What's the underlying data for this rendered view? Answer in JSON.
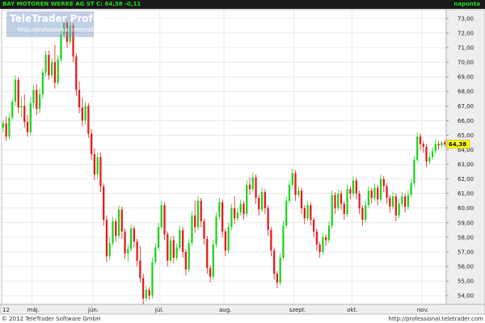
{
  "header": {
    "title": "BAY MOTOREN WERKE AG ST  C: 64,38  -0,11",
    "period": "naponta"
  },
  "watermark": {
    "brand": "TeleTrader Professional",
    "url": "http://professional.teletrader.com"
  },
  "footer": {
    "copyright": "© 2012 TeleTrader Software GmbH",
    "url": "http://professional.teletrader.com"
  },
  "colors": {
    "up": "#1fd21f",
    "down": "#e81818",
    "grid": "#d6d6d6",
    "axis_bg": "#eeeeee",
    "last_price_bg": "#ffff00"
  },
  "chart_data": {
    "type": "candlestick",
    "series_name": "BAY MOTOREN WERKE AG ST",
    "last_close": "64,38",
    "change": "-0,11",
    "y_ticks": [
      "54,00",
      "55,00",
      "56,00",
      "57,00",
      "58,00",
      "59,00",
      "60,00",
      "61,00",
      "62,00",
      "63,00",
      "64,00",
      "65,00",
      "66,00",
      "67,00",
      "68,00",
      "69,00",
      "70,00",
      "71,00",
      "72,00",
      "73,00"
    ],
    "ylim": [
      53.4,
      73.6
    ],
    "x_ticks": [
      {
        "label": "12",
        "index": 0
      },
      {
        "label": "máj.",
        "index": 10
      },
      {
        "label": "jún.",
        "index": 30
      },
      {
        "label": "júl.",
        "index": 52
      },
      {
        "label": "aug.",
        "index": 73
      },
      {
        "label": "szept.",
        "index": 96
      },
      {
        "label": "okt.",
        "index": 115
      },
      {
        "label": "nov.",
        "index": 138
      }
    ],
    "n_candles": 146,
    "ohlc": [
      [
        65.5,
        66.0,
        65.2,
        65.8
      ],
      [
        65.8,
        66.3,
        64.6,
        64.9
      ],
      [
        64.9,
        66.5,
        64.7,
        66.2
      ],
      [
        66.2,
        67.5,
        66.0,
        67.3
      ],
      [
        67.3,
        69.1,
        67.0,
        68.8
      ],
      [
        68.8,
        69.0,
        66.5,
        66.9
      ],
      [
        66.9,
        67.6,
        66.2,
        67.0
      ],
      [
        67.0,
        67.8,
        65.5,
        65.9
      ],
      [
        65.9,
        66.4,
        64.9,
        65.2
      ],
      [
        65.2,
        67.6,
        65.0,
        67.2
      ],
      [
        67.2,
        68.4,
        66.8,
        68.1
      ],
      [
        68.1,
        68.5,
        66.4,
        66.8
      ],
      [
        66.8,
        68.2,
        66.5,
        67.8
      ],
      [
        67.8,
        69.6,
        67.5,
        69.3
      ],
      [
        69.3,
        70.8,
        69.0,
        70.5
      ],
      [
        70.5,
        70.8,
        68.8,
        69.1
      ],
      [
        69.1,
        70.3,
        68.9,
        70.0
      ],
      [
        70.0,
        71.2,
        68.2,
        68.6
      ],
      [
        68.6,
        70.5,
        68.4,
        70.2
      ],
      [
        70.2,
        72.2,
        70.0,
        71.9
      ],
      [
        71.9,
        73.2,
        71.6,
        72.7
      ],
      [
        72.7,
        72.9,
        71.0,
        71.4
      ],
      [
        71.4,
        72.8,
        71.2,
        72.5
      ],
      [
        72.5,
        72.7,
        70.0,
        70.4
      ],
      [
        70.4,
        70.6,
        67.7,
        68.1
      ],
      [
        68.1,
        68.7,
        66.5,
        66.9
      ],
      [
        66.9,
        67.6,
        65.6,
        66.0
      ],
      [
        66.0,
        67.3,
        65.7,
        67.0
      ],
      [
        67.0,
        67.2,
        64.8,
        65.1
      ],
      [
        65.1,
        65.4,
        63.3,
        63.7
      ],
      [
        63.7,
        64.1,
        61.9,
        62.3
      ],
      [
        62.3,
        63.8,
        62.0,
        63.5
      ],
      [
        63.5,
        63.8,
        61.1,
        61.5
      ],
      [
        61.5,
        61.7,
        58.8,
        59.2
      ],
      [
        59.2,
        59.5,
        56.3,
        56.7
      ],
      [
        56.7,
        58.0,
        56.4,
        57.6
      ],
      [
        57.6,
        59.4,
        57.4,
        59.1
      ],
      [
        59.1,
        59.3,
        57.7,
        58.1
      ],
      [
        58.1,
        60.2,
        57.9,
        59.9
      ],
      [
        59.9,
        60.1,
        57.9,
        58.4
      ],
      [
        58.4,
        58.6,
        56.5,
        56.9
      ],
      [
        56.9,
        57.5,
        56.3,
        57.2
      ],
      [
        57.2,
        58.9,
        57.0,
        58.6
      ],
      [
        58.6,
        58.8,
        57.3,
        57.7
      ],
      [
        57.7,
        57.9,
        56.0,
        56.4
      ],
      [
        56.4,
        57.4,
        54.9,
        55.2
      ],
      [
        55.2,
        55.5,
        53.4,
        53.8
      ],
      [
        53.8,
        54.7,
        53.6,
        54.4
      ],
      [
        54.4,
        54.6,
        53.7,
        54.0
      ],
      [
        54.0,
        56.6,
        53.8,
        56.3
      ],
      [
        56.3,
        57.6,
        56.1,
        57.3
      ],
      [
        57.3,
        59.0,
        57.1,
        58.7
      ],
      [
        58.7,
        60.5,
        58.5,
        60.2
      ],
      [
        60.2,
        60.4,
        57.8,
        58.2
      ],
      [
        58.2,
        58.4,
        56.0,
        56.4
      ],
      [
        56.4,
        58.1,
        56.2,
        57.8
      ],
      [
        57.8,
        58.1,
        56.2,
        56.6
      ],
      [
        56.6,
        57.6,
        56.4,
        57.3
      ],
      [
        57.3,
        58.8,
        57.1,
        58.5
      ],
      [
        58.5,
        58.7,
        56.6,
        57.0
      ],
      [
        57.0,
        57.2,
        55.4,
        55.8
      ],
      [
        55.8,
        57.9,
        55.6,
        57.6
      ],
      [
        57.6,
        59.8,
        57.4,
        59.5
      ],
      [
        59.5,
        60.5,
        58.3,
        58.7
      ],
      [
        58.7,
        60.8,
        58.5,
        60.5
      ],
      [
        60.5,
        60.7,
        58.7,
        59.1
      ],
      [
        59.1,
        59.3,
        57.5,
        57.9
      ],
      [
        57.9,
        58.1,
        55.5,
        55.9
      ],
      [
        55.9,
        56.1,
        54.9,
        55.3
      ],
      [
        55.3,
        57.8,
        55.1,
        57.5
      ],
      [
        57.5,
        59.7,
        57.3,
        59.4
      ],
      [
        59.4,
        60.7,
        59.2,
        60.4
      ],
      [
        60.4,
        60.6,
        58.0,
        58.4
      ],
      [
        58.4,
        58.6,
        56.7,
        57.1
      ],
      [
        57.1,
        59.0,
        56.9,
        58.7
      ],
      [
        58.7,
        60.3,
        58.5,
        60.0
      ],
      [
        60.0,
        60.8,
        58.9,
        59.3
      ],
      [
        59.3,
        60.0,
        59.1,
        59.7
      ],
      [
        59.7,
        60.6,
        59.5,
        60.3
      ],
      [
        60.3,
        60.5,
        59.2,
        59.6
      ],
      [
        59.6,
        61.9,
        59.4,
        61.6
      ],
      [
        61.6,
        62.1,
        60.9,
        61.3
      ],
      [
        61.3,
        62.4,
        61.1,
        62.1
      ],
      [
        62.1,
        62.3,
        60.3,
        60.7
      ],
      [
        60.7,
        60.9,
        59.5,
        59.9
      ],
      [
        59.9,
        61.4,
        59.7,
        61.1
      ],
      [
        61.1,
        61.3,
        59.6,
        60.0
      ],
      [
        60.0,
        60.2,
        58.1,
        58.5
      ],
      [
        58.5,
        58.7,
        56.7,
        57.1
      ],
      [
        57.1,
        57.3,
        55.1,
        55.5
      ],
      [
        55.5,
        55.7,
        54.5,
        54.9
      ],
      [
        54.9,
        56.9,
        54.7,
        56.6
      ],
      [
        56.6,
        59.1,
        56.4,
        58.8
      ],
      [
        58.8,
        60.8,
        58.6,
        60.5
      ],
      [
        60.5,
        61.9,
        60.3,
        61.6
      ],
      [
        61.6,
        62.7,
        61.4,
        62.4
      ],
      [
        62.4,
        62.6,
        60.5,
        60.9
      ],
      [
        60.9,
        61.5,
        60.7,
        61.2
      ],
      [
        61.2,
        61.4,
        59.6,
        60.0
      ],
      [
        60.0,
        60.2,
        58.9,
        59.3
      ],
      [
        59.3,
        60.5,
        59.1,
        60.2
      ],
      [
        60.2,
        60.4,
        58.8,
        59.2
      ],
      [
        59.2,
        59.4,
        58.0,
        58.4
      ],
      [
        58.4,
        58.6,
        57.1,
        57.5
      ],
      [
        57.5,
        57.7,
        56.6,
        57.0
      ],
      [
        57.0,
        58.3,
        56.8,
        58.0
      ],
      [
        58.0,
        58.2,
        57.4,
        57.8
      ],
      [
        57.8,
        59.1,
        57.6,
        58.8
      ],
      [
        58.8,
        61.2,
        58.6,
        60.9
      ],
      [
        60.9,
        61.1,
        59.6,
        60.0
      ],
      [
        60.0,
        61.3,
        59.8,
        61.0
      ],
      [
        61.0,
        61.2,
        59.9,
        60.3
      ],
      [
        60.3,
        60.5,
        59.2,
        59.6
      ],
      [
        59.6,
        61.6,
        59.4,
        61.3
      ],
      [
        61.3,
        61.5,
        60.6,
        61.0
      ],
      [
        61.0,
        62.2,
        60.8,
        61.9
      ],
      [
        61.9,
        62.1,
        60.6,
        61.0
      ],
      [
        61.0,
        61.2,
        59.6,
        60.0
      ],
      [
        60.0,
        60.2,
        58.8,
        59.2
      ],
      [
        59.2,
        60.5,
        59.0,
        60.2
      ],
      [
        60.2,
        61.5,
        60.0,
        61.2
      ],
      [
        61.2,
        61.4,
        60.3,
        60.7
      ],
      [
        60.7,
        61.7,
        60.5,
        61.4
      ],
      [
        61.4,
        61.6,
        60.2,
        60.6
      ],
      [
        60.6,
        62.3,
        60.4,
        62.0
      ],
      [
        62.0,
        62.2,
        61.1,
        61.5
      ],
      [
        61.5,
        61.7,
        60.3,
        60.7
      ],
      [
        60.7,
        60.9,
        59.7,
        60.1
      ],
      [
        60.1,
        61.1,
        59.9,
        60.8
      ],
      [
        60.8,
        61.0,
        59.1,
        59.5
      ],
      [
        59.5,
        60.6,
        59.3,
        60.3
      ],
      [
        60.3,
        61.1,
        60.1,
        60.8
      ],
      [
        60.8,
        61.0,
        59.7,
        60.1
      ],
      [
        60.1,
        61.2,
        59.9,
        60.9
      ],
      [
        60.9,
        62.0,
        60.7,
        61.7
      ],
      [
        61.7,
        63.6,
        61.5,
        63.3
      ],
      [
        63.3,
        65.2,
        63.1,
        64.9
      ],
      [
        64.9,
        65.1,
        64.0,
        64.4
      ],
      [
        64.4,
        64.6,
        63.8,
        64.2
      ],
      [
        64.2,
        64.4,
        62.8,
        63.2
      ],
      [
        63.2,
        63.8,
        63.0,
        63.5
      ],
      [
        63.5,
        64.2,
        63.3,
        63.9
      ],
      [
        63.9,
        64.7,
        63.7,
        64.4
      ],
      [
        64.4,
        64.6,
        64.0,
        64.3
      ],
      [
        64.3,
        64.6,
        64.1,
        64.5
      ],
      [
        64.5,
        64.7,
        64.2,
        64.38
      ]
    ]
  }
}
